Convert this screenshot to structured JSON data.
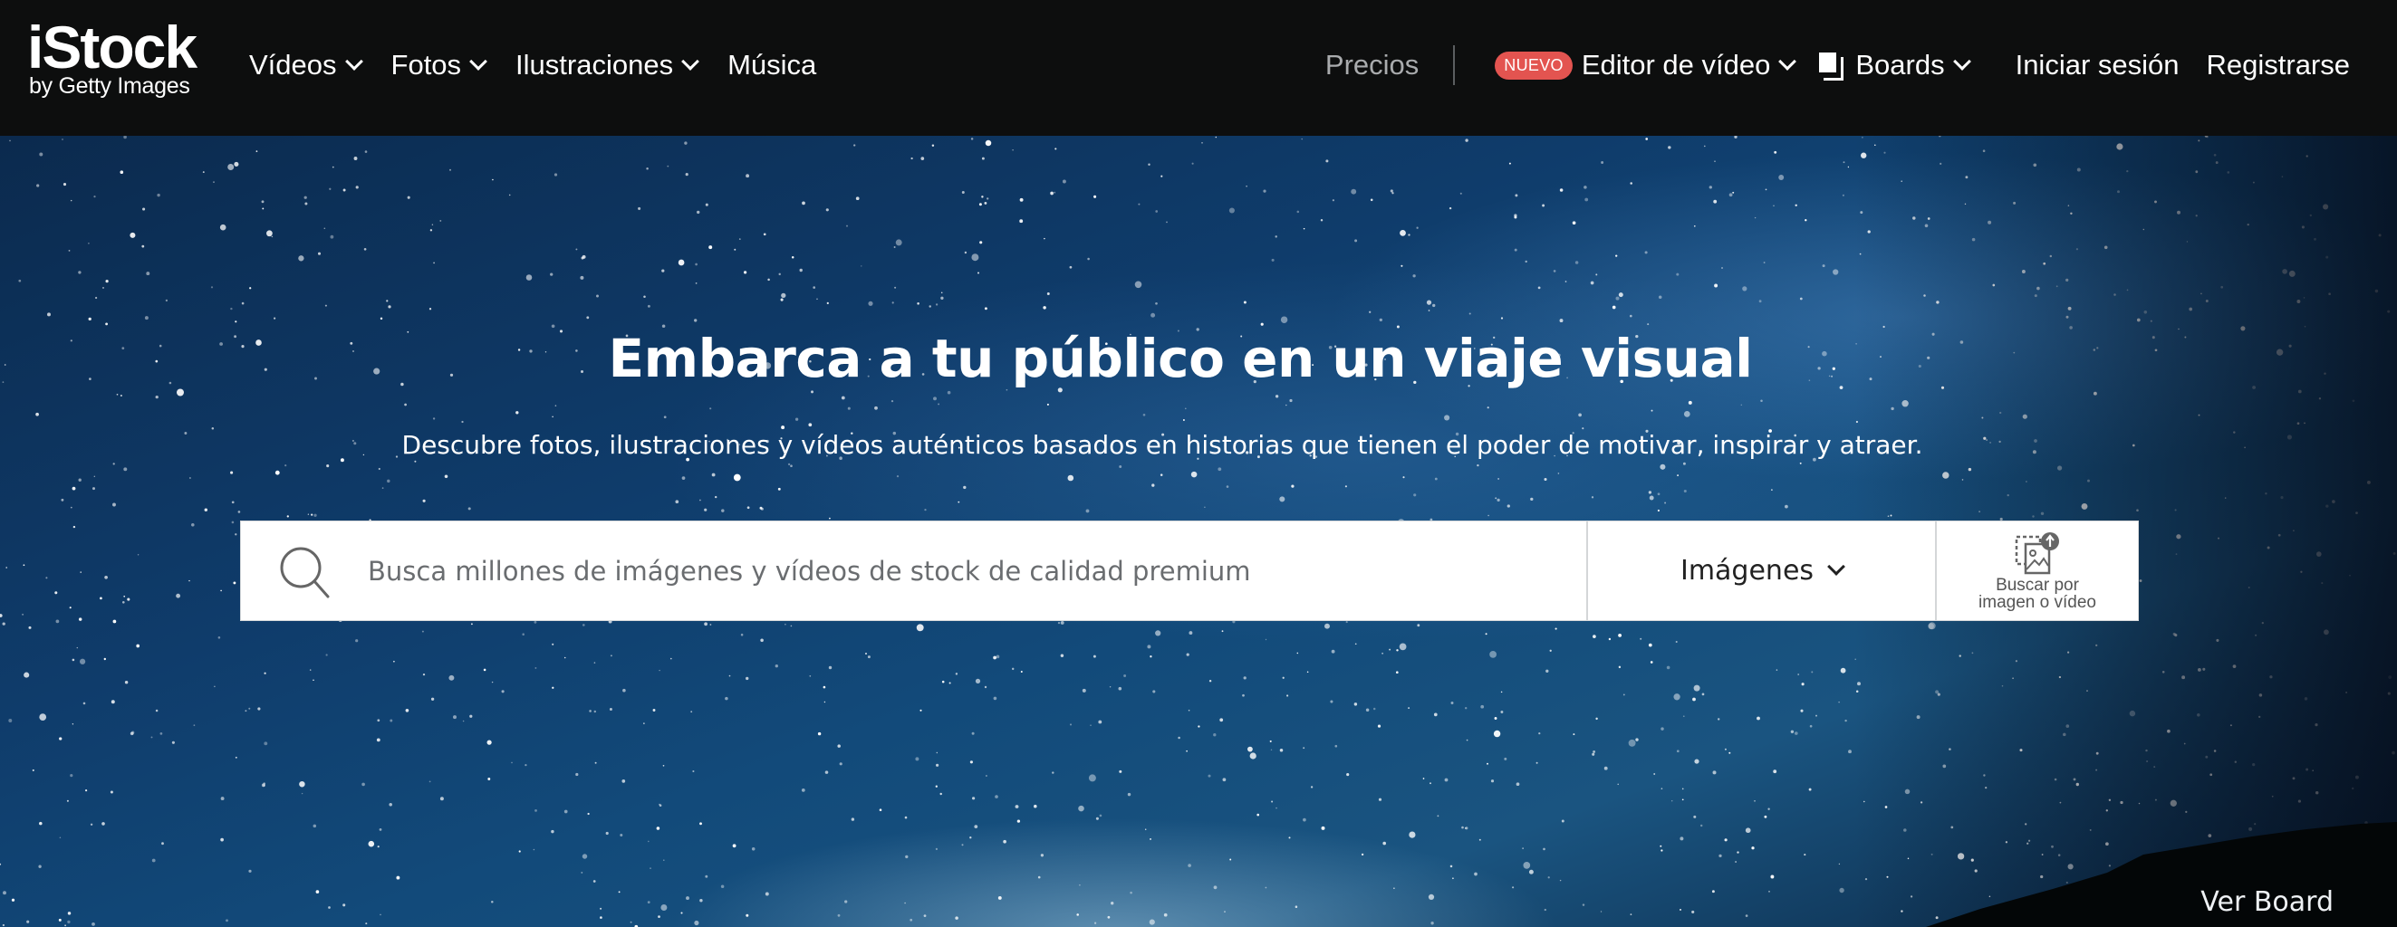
{
  "header": {
    "logo": {
      "main": "iStock",
      "sub": "by Getty Images"
    },
    "nav_left": [
      {
        "label": "Vídeos",
        "has_dropdown": true
      },
      {
        "label": "Fotos",
        "has_dropdown": true
      },
      {
        "label": "Ilustraciones",
        "has_dropdown": true
      },
      {
        "label": "Música",
        "has_dropdown": false
      }
    ],
    "precios": "Precios",
    "badge_new": "NUEVO",
    "video_editor": "Editor de vídeo",
    "boards": "Boards",
    "login": "Iniciar sesión",
    "register": "Registrarse"
  },
  "hero": {
    "title": "Embarca a tu público en un viaje visual",
    "subtitle": "Descubre fotos, ilustraciones y vídeos auténticos basados en historias que tienen el poder de motivar, inspirar y atraer.",
    "search": {
      "placeholder": "Busca millones de imágenes y vídeos de stock de calidad premium",
      "value": "",
      "type_selected": "Imágenes",
      "visual_search_line1": "Buscar por",
      "visual_search_line2": "imagen o vídeo"
    },
    "ver_board": "Ver Board"
  },
  "colors": {
    "header_bg": "#0d0e0e",
    "badge": "#e35450",
    "precios": "#a9abad",
    "hero_blue": "#124a7a"
  }
}
